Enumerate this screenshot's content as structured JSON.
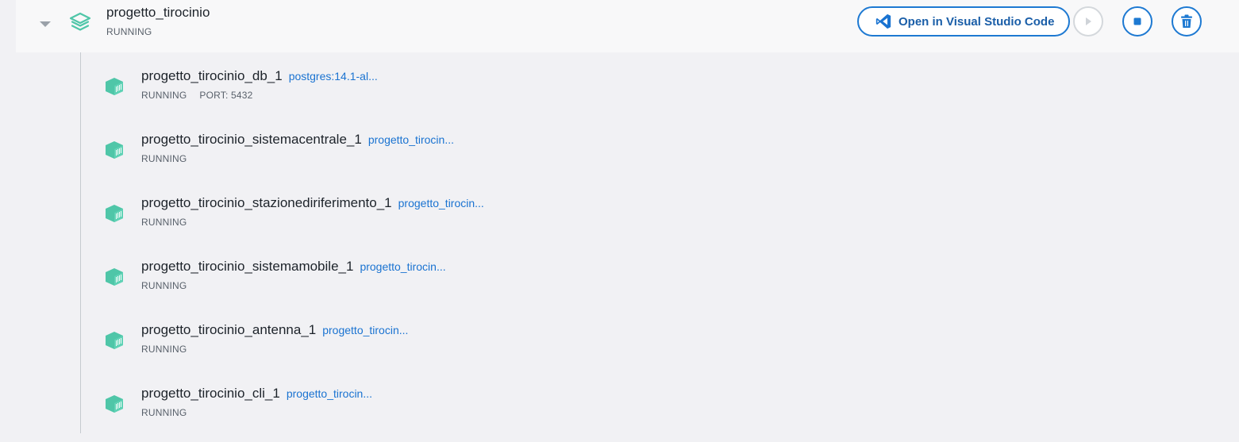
{
  "stack": {
    "name": "progetto_tirocinio",
    "status": "RUNNING"
  },
  "actions": {
    "open_vscode_label": "Open in Visual Studio Code",
    "play_icon": "play-icon",
    "stop_icon": "stop-icon",
    "delete_icon": "trash-icon"
  },
  "colors": {
    "accent": "#1d79d2",
    "container_icon": "#4fc6a8",
    "link": "#1a73d1"
  },
  "containers": [
    {
      "name": "progetto_tirocinio_db_1",
      "image": "postgres:14.1-al...",
      "status": "RUNNING",
      "port": "PORT: 5432"
    },
    {
      "name": "progetto_tirocinio_sistemacentrale_1",
      "image": "progetto_tirocin...",
      "status": "RUNNING"
    },
    {
      "name": "progetto_tirocinio_stazionediriferimento_1",
      "image": "progetto_tirocin...",
      "status": "RUNNING"
    },
    {
      "name": "progetto_tirocinio_sistemamobile_1",
      "image": "progetto_tirocin...",
      "status": "RUNNING"
    },
    {
      "name": "progetto_tirocinio_antenna_1",
      "image": "progetto_tirocin...",
      "status": "RUNNING"
    },
    {
      "name": "progetto_tirocinio_cli_1",
      "image": "progetto_tirocin...",
      "status": "RUNNING"
    }
  ]
}
